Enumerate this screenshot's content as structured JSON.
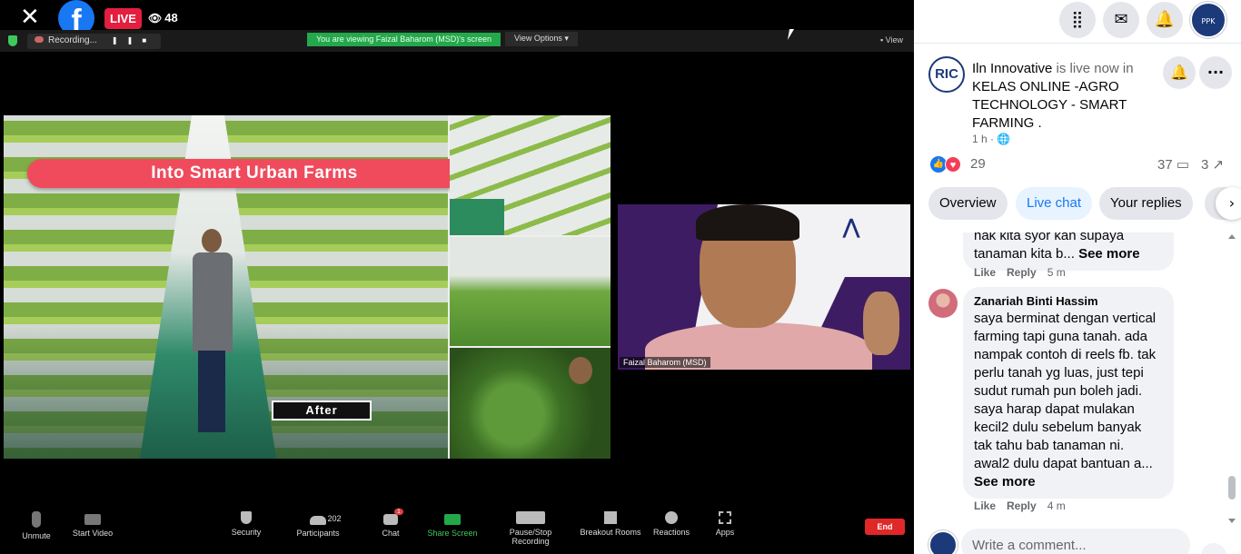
{
  "fb": {
    "live_label": "LIVE",
    "viewer_count": "48",
    "logo_letter": "f"
  },
  "zoom": {
    "recording_label": "Recording...",
    "viewing_banner": "You are viewing Faizal Baharom (MSD)'s screen",
    "view_options": "View Options",
    "view_label": "View",
    "speaker_name": "Faizal Baharom (MSD)",
    "toolbar": {
      "unmute": "Unmute",
      "start_video": "Start Video",
      "security": "Security",
      "participants": "Participants",
      "participants_count": "202",
      "chat": "Chat",
      "chat_badge": "1",
      "share_screen": "Share Screen",
      "pause_recording": "Pause/Stop Recording",
      "breakout_rooms": "Breakout Rooms",
      "reactions": "Reactions",
      "apps": "Apps",
      "end": "End"
    }
  },
  "slide": {
    "title": "Into Smart Urban Farms",
    "tag": "After"
  },
  "panel": {
    "avatar_text": "RIC",
    "page_name": "Iln Innovative",
    "live_text": " is live now in ",
    "group_name": "KELAS ONLINE -AGRO TECHNOLOGY - SMART FARMING .",
    "time": "1 h · ",
    "reaction_count": "29",
    "comment_count": "37",
    "share_count": "3",
    "tabs": [
      {
        "label": "Overview"
      },
      {
        "label": "Live chat"
      },
      {
        "label": "Your replies"
      }
    ],
    "comments": [
      {
        "text": "nak kita syor kan supaya tanaman kita b... ",
        "see_more": "See more",
        "like": "Like",
        "reply": "Reply",
        "time": "5 m"
      },
      {
        "author": "Zanariah Binti Hassim",
        "text": "saya berminat dengan vertical farming tapi guna tanah. ada nampak contoh di reels fb. tak perlu tanah yg luas, just tepi sudut rumah pun boleh jadi. saya harap dapat mulakan kecil2 dulu sebelum banyak tak tahu bab tanaman ni. awal2 dulu dapat bantuan a... ",
        "see_more": "See more",
        "like": "Like",
        "reply": "Reply",
        "time": "4 m"
      }
    ],
    "comment_placeholder": "Write a comment..."
  },
  "colors": {
    "fb_blue": "#1877f2",
    "live_red": "#e41e3f",
    "zoom_green": "#23a84c",
    "slide_band": "#ef4b5d"
  }
}
